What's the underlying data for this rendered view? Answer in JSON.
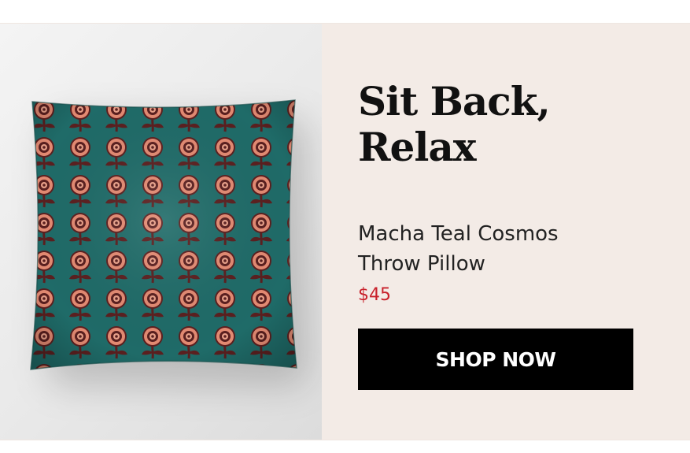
{
  "promo": {
    "headline_line1": "Sit Back,",
    "headline_line2": "Relax",
    "product_name_line1": "Macha Teal Cosmos",
    "product_name_line2": "Throw Pillow",
    "price": "$45",
    "cta_label": "SHOP NOW"
  },
  "product_image": {
    "alt": "Macha Teal Cosmos Throw Pillow",
    "icon": "throw-pillow-image"
  },
  "colors": {
    "banner_background": "#f3ebe6",
    "pillow_teal": "#1f6b68",
    "flower_coral": "#e38a72",
    "flower_dark": "#5a1f1f",
    "price_red": "#c8202a",
    "button_black": "#000000"
  }
}
